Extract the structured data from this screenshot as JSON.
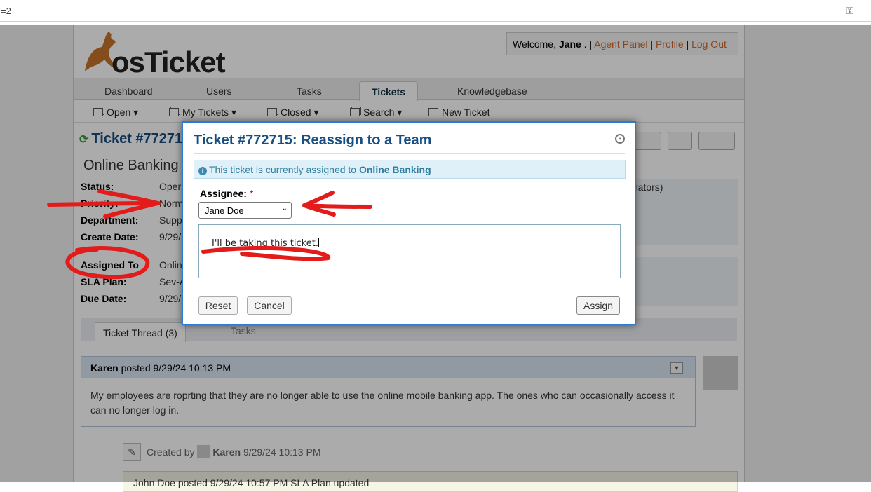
{
  "browser": {
    "url": "=2"
  },
  "header": {
    "logo_text": "osTicket",
    "welcome_prefix": "Welcome, ",
    "user": "Jane",
    "welcome_suffix": " . | ",
    "agent_panel": "Agent Panel",
    "profile": "Profile",
    "logout": "Log Out",
    "sep": " | "
  },
  "nav": {
    "tabs": [
      "Dashboard",
      "Users",
      "Tasks",
      "Tickets",
      "Knowledgebase"
    ],
    "active": "Tickets"
  },
  "subnav": [
    "Open",
    "My Tickets",
    "Closed",
    "Search",
    "New Ticket"
  ],
  "ticket": {
    "heading": "Ticket #77271",
    "subject": "Online Banking",
    "fields": [
      {
        "label": "Status:",
        "value": "Oper"
      },
      {
        "label": "Priority:",
        "value": "Norm"
      },
      {
        "label": "Department:",
        "value": "Supp"
      },
      {
        "label": "Create Date:",
        "value": "9/29/"
      },
      {
        "label": "Assigned To",
        "value": "Onlin"
      },
      {
        "label": "SLA Plan:",
        "value": "Sev-A"
      },
      {
        "label": "Due Date:",
        "value": "9/29/"
      }
    ],
    "right_fragment": "rators)"
  },
  "thread": {
    "tab_thread": "Ticket Thread (3)",
    "tab_tasks": "Tasks",
    "message": {
      "author": "Karen",
      "posted": " posted 9/29/24 10:13 PM",
      "body": "My employees are roprting that they are no longer able to use the online mobile banking app. The ones who can occasionally access it can no longer log in."
    },
    "created_by": "Created by",
    "created_author": "Karen",
    "created_date": "9/29/24 10:13 PM",
    "next_fragment": "John Doe posted 9/29/24 10:57 PM     SLA Plan updated"
  },
  "dialog": {
    "title": "Ticket #772715: Reassign to a Team",
    "notice_prefix": "This ticket is currently assigned to ",
    "notice_team": "Online Banking",
    "assignee_label": "Assignee:",
    "required_mark": "*",
    "assignee_value": "Jane Doe",
    "comment": "I'll be taking this ticket.",
    "reset": "Reset",
    "cancel": "Cancel",
    "assign": "Assign"
  },
  "annotation_color": "#e31b1b"
}
